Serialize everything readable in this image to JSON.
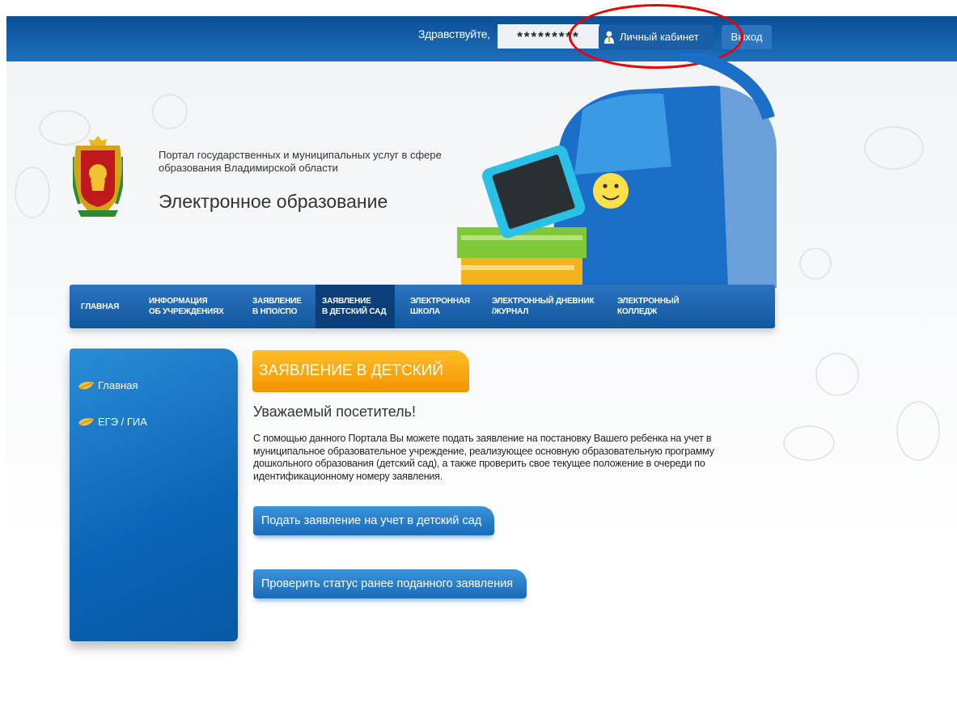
{
  "header": {
    "greeting": "Здравствуйте,",
    "username": "*********",
    "cabinet_label": "Личный кабинет",
    "logout_label": "Выход"
  },
  "branding": {
    "subtitle": "Портал государственных и муниципальных услуг в сфере образования Владимирской области",
    "title": "Электронное образование"
  },
  "nav": {
    "items": [
      {
        "line1": "Главная",
        "line2": ""
      },
      {
        "line1": "Информация",
        "line2": "об учреждениях"
      },
      {
        "line1": "Заявление",
        "line2": "в НПО/СПО"
      },
      {
        "line1": "Заявление",
        "line2": "в детский сад"
      },
      {
        "line1": "Электронная",
        "line2": "школа"
      },
      {
        "line1": "Электронный дневник",
        "line2": "/журнал"
      },
      {
        "line1": "Электронный",
        "line2": "колледж"
      }
    ],
    "active_index": 3
  },
  "sidebar": {
    "items": [
      {
        "label": "Главная"
      },
      {
        "label": "ЕГЭ / ГИА"
      }
    ]
  },
  "main": {
    "section_title": "ЗАЯВЛЕНИЕ В ДЕТСКИЙ САД",
    "greeting": "Уважаемый посетитель!",
    "description": "С помощью данного Портала Вы можете подать заявление на постановку Вашего ребенка на учет в муниципальное образовательное учреждение, реализующее основную образовательную программу дошкольного образования (детский сад), а также проверить свое текущее положение в очереди по идентификационному номеру заявления.",
    "submit_button": "Подать заявление на учет в детский сад",
    "status_button": "Проверить статус ранее поданного заявления"
  },
  "colors": {
    "header_blue": "#1a5ea6",
    "nav_blue": "#13589f",
    "accent_orange": "#f39300",
    "highlight_red": "#e00000"
  }
}
